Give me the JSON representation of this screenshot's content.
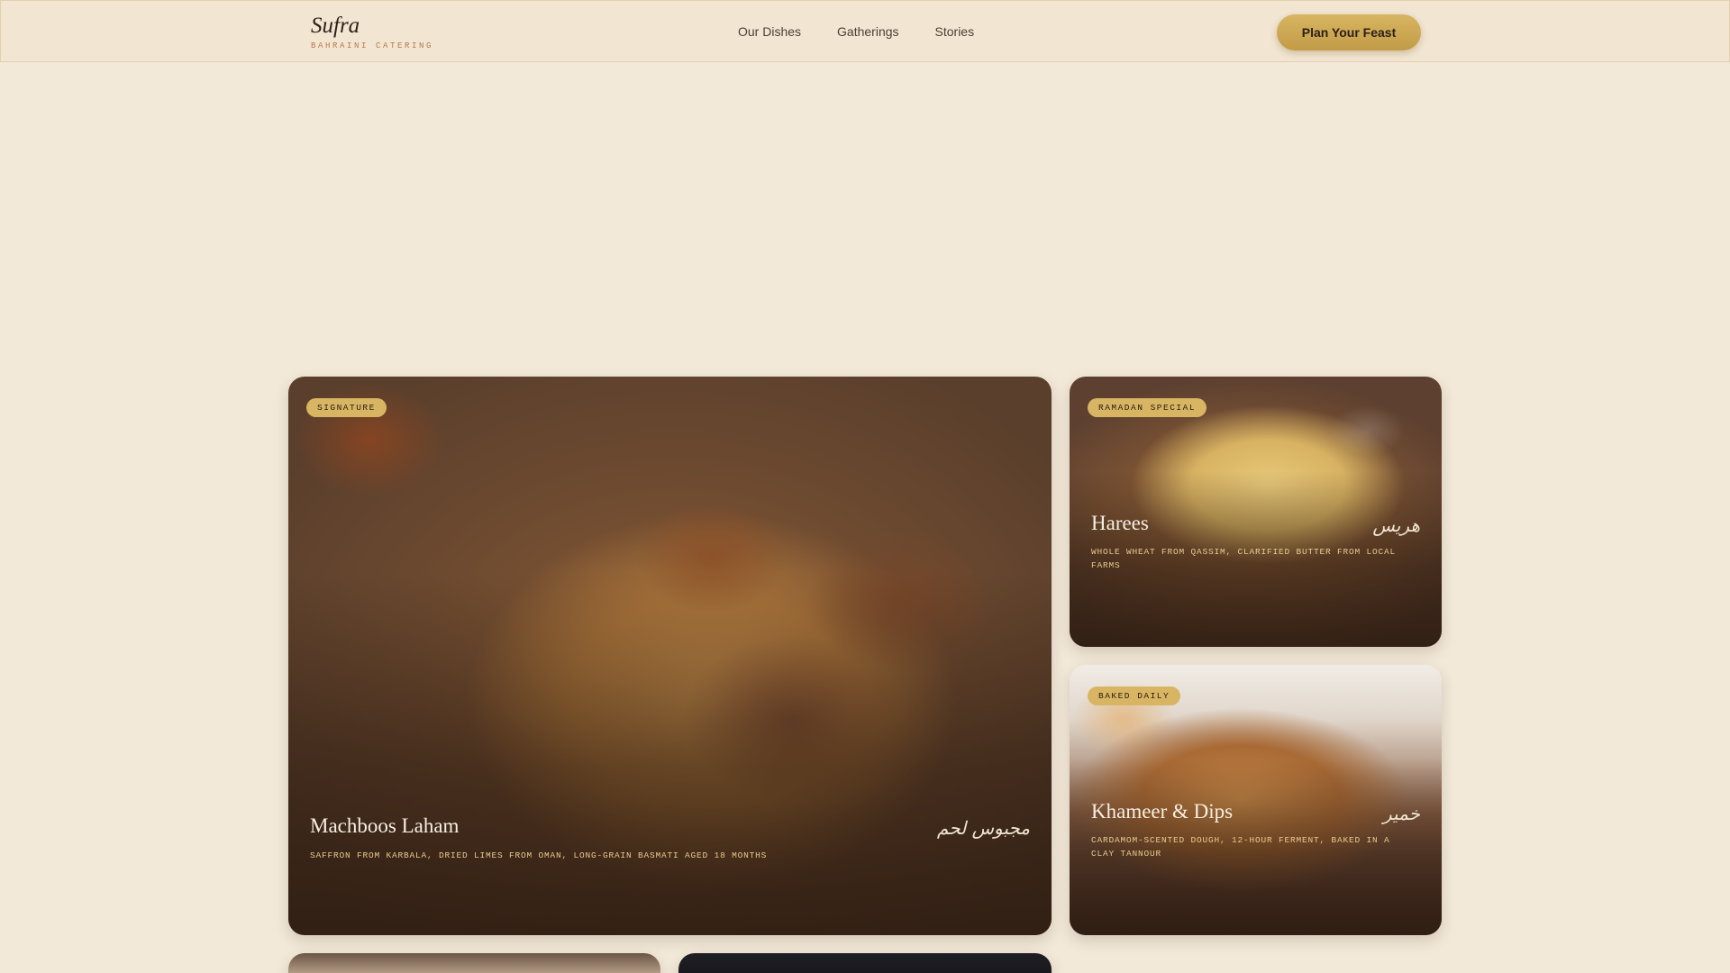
{
  "header": {
    "brand_name": "Sufra",
    "brand_tagline": "BAHRAINI CATERING",
    "nav": [
      "Our Dishes",
      "Gatherings",
      "Stories"
    ],
    "cta_label": "Plan Your Feast"
  },
  "dishes": [
    {
      "badge": "SIGNATURE",
      "name": "Machboos Laham",
      "arabic": "مجبوس لحم",
      "description": "SAFFRON FROM KARBALA, DRIED LIMES FROM OMAN, LONG-GRAIN BASMATI AGED 18 MONTHS"
    },
    {
      "badge": "RAMADAN SPECIAL",
      "name": "Harees",
      "arabic": "هريس",
      "description": "WHOLE WHEAT FROM QASSIM, CLARIFIED BUTTER FROM LOCAL FARMS"
    },
    {
      "badge": "BAKED DAILY",
      "name": "Khameer & Dips",
      "arabic": "خمير",
      "description": "CARDAMOM-SCENTED DOUGH, 12-HOUR FERMENT, BAKED IN A CLAY TANNOUR"
    }
  ],
  "colors": {
    "background": "#f3e9d9",
    "accent_gold": "#d8b562",
    "tagline": "#b5784a",
    "card_description": "#e8c98e"
  }
}
